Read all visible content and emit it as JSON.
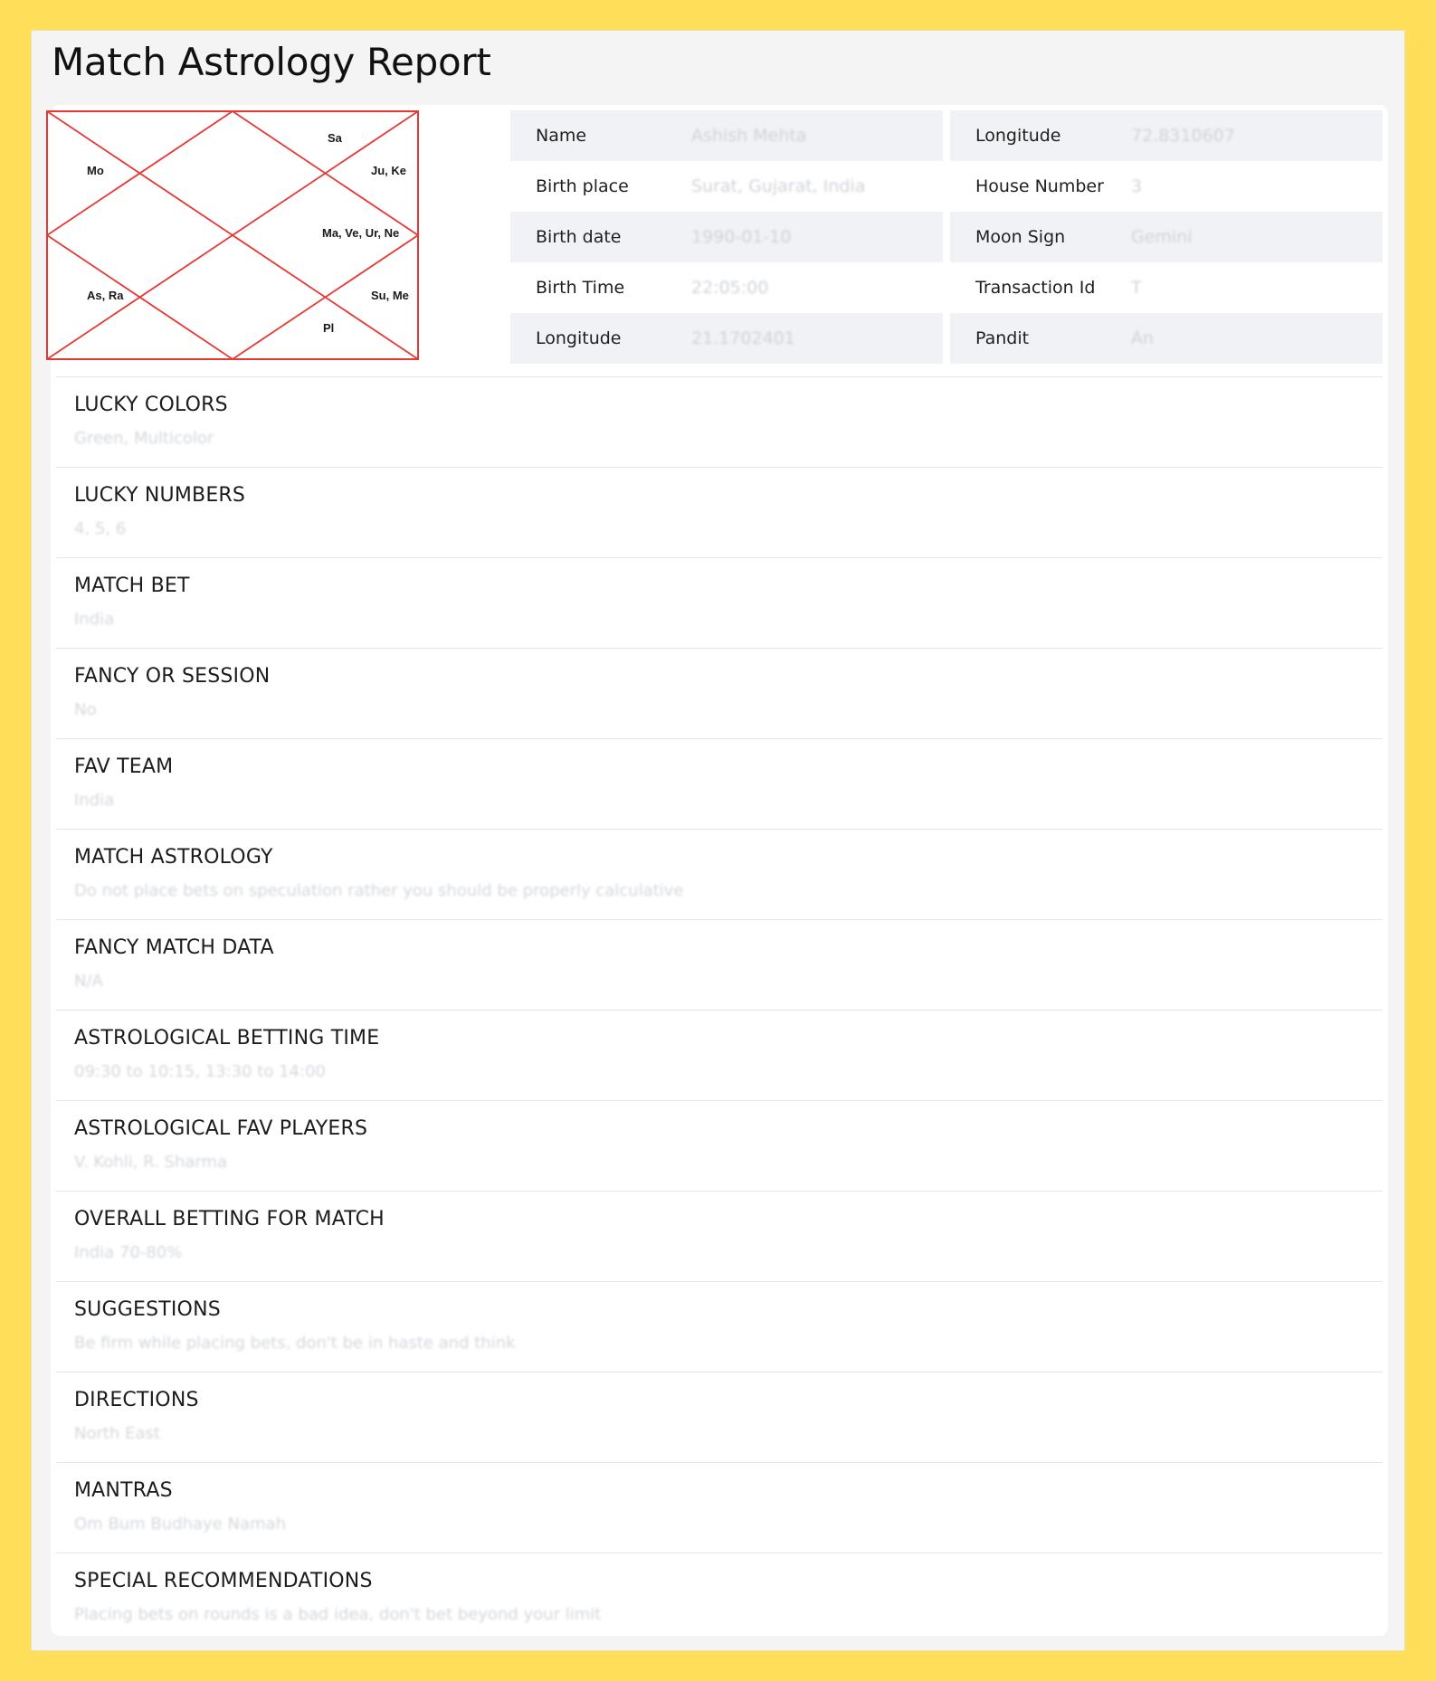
{
  "page": {
    "title": "Match Astrology Report"
  },
  "kundli": {
    "line_color": "#e53935",
    "houses": {
      "h12": "Sa",
      "h2": "Mo",
      "h11": "Ju, Ke",
      "h10": "Ma, Ve, Ur, Ne",
      "h4": "As, Ra",
      "h9": "Su, Me",
      "h8": "Pl"
    }
  },
  "details": [
    {
      "label": "Name",
      "value": "Ashish Mehta"
    },
    {
      "label": "Longitude",
      "value": "72.8310607"
    },
    {
      "label": "Birth place",
      "value": "Surat, Gujarat, India"
    },
    {
      "label": "House Number",
      "value": "3"
    },
    {
      "label": "Birth date",
      "value": "1990-01-10"
    },
    {
      "label": "Moon Sign",
      "value": "Gemini"
    },
    {
      "label": "Birth Time",
      "value": "22:05:00"
    },
    {
      "label": "Transaction Id",
      "value": "T"
    },
    {
      "label": "Longitude",
      "value": "21.1702401"
    },
    {
      "label": "Pandit",
      "value": "An"
    }
  ],
  "sections": [
    {
      "title": "LUCKY COLORS",
      "value": "Green, Multicolor"
    },
    {
      "title": "LUCKY NUMBERS",
      "value": "4, 5, 6"
    },
    {
      "title": "MATCH BET",
      "value": "India"
    },
    {
      "title": "FANCY OR SESSION",
      "value": "No"
    },
    {
      "title": "FAV TEAM",
      "value": "India"
    },
    {
      "title": "MATCH ASTROLOGY",
      "value": "Do not place bets on speculation rather you should be properly calculative"
    },
    {
      "title": "FANCY MATCH DATA",
      "value": "N/A"
    },
    {
      "title": "ASTROLOGICAL BETTING TIME",
      "value": "09:30 to 10:15, 13:30 to 14:00"
    },
    {
      "title": "ASTROLOGICAL FAV PLAYERS",
      "value": "V. Kohli, R. Sharma"
    },
    {
      "title": "OVERALL BETTING FOR MATCH",
      "value": "India 70-80%"
    },
    {
      "title": "SUGGESTIONS",
      "value": "Be firm while placing bets, don't be in haste and think"
    },
    {
      "title": "DIRECTIONS",
      "value": "North East"
    },
    {
      "title": "MANTRAS",
      "value": "Om Bum Budhaye Namah"
    },
    {
      "title": "SPECIAL RECOMMENDATIONS",
      "value": "Placing bets on rounds is a bad idea, don't bet beyond your limit"
    }
  ]
}
